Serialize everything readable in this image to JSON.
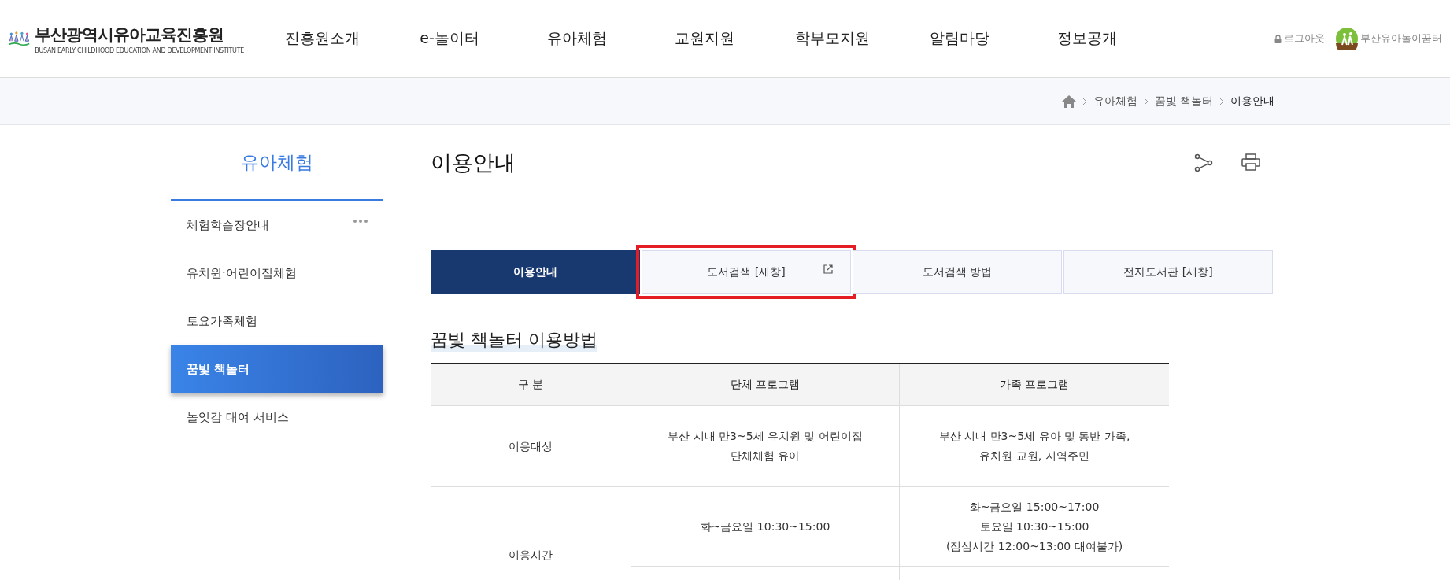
{
  "header": {
    "logo": {
      "name": "부산광역시유아교육진흥원",
      "subtitle": "BUSAN EARLY CHILDHOOD EDUCATION AND DEVELOPMENT INSTITUTE"
    },
    "nav": [
      "진흥원소개",
      "e-놀이터",
      "유아체험",
      "교원지원",
      "학부모지원",
      "알림마당",
      "정보공개"
    ],
    "utility": [
      {
        "kind": "logout",
        "label": "로그아웃"
      },
      {
        "kind": "site",
        "label": "부산유아놀이꿈터"
      }
    ]
  },
  "breadcrumb": [
    "유아체험",
    "꿈빛 책놀터",
    "이용안내"
  ],
  "sidebar": {
    "title": "유아체험",
    "items": [
      {
        "label": "체험학습장안내",
        "selected": false,
        "expandable": true
      },
      {
        "label": "유치원·어린이집체험",
        "selected": false,
        "expandable": false
      },
      {
        "label": "토요가족체험",
        "selected": false,
        "expandable": false
      },
      {
        "label": "꿈빛 책놀터",
        "selected": true,
        "expandable": false
      },
      {
        "label": "놀잇감 대여 서비스",
        "selected": false,
        "expandable": false
      }
    ]
  },
  "page": {
    "title": "이용안내",
    "tabs": [
      {
        "label": "이용안내",
        "selected": true,
        "new_window": false,
        "highlighted": false
      },
      {
        "label": "도서검색 [새창]",
        "selected": false,
        "new_window": true,
        "highlighted": true
      },
      {
        "label": "도서검색 방법",
        "selected": false,
        "new_window": false,
        "highlighted": false
      },
      {
        "label": "전자도서관 [새창]",
        "selected": false,
        "new_window": false,
        "highlighted": false
      }
    ],
    "section_title": "꿈빛 책놀터 이용방법",
    "table": {
      "columns": [
        "구 분",
        "단체 프로그램",
        "가족 프로그램"
      ],
      "rows": [
        {
          "cells": [
            "이용대상",
            "부산 시내 만3~5세 유치원 및 어린이집\n단체체험 유아",
            "부산 시내 만3~5세 유아 및 동반 가족,\n유치원 교원, 지역주민"
          ]
        },
        {
          "cells": [
            "이용시간",
            "화~금요일 10:30~15:00",
            "화~금요일 15:00~17:00\n토요일 10:30~15:00\n(점심시간 12:00~13:00 대여불가)"
          ]
        }
      ]
    }
  }
}
